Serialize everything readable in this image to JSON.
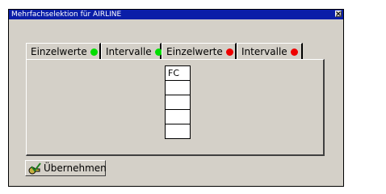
{
  "window": {
    "title": "Mehrfachselektion für AIRLINE"
  },
  "tabs": [
    {
      "label": "Einzelwerte",
      "dot_color": "#00dd00"
    },
    {
      "label": "Intervalle",
      "dot_color": "#00dd00"
    },
    {
      "label": "Einzelwerte",
      "dot_color": "#ee0000"
    },
    {
      "label": "Intervalle",
      "dot_color": "#ee0000"
    }
  ],
  "value_table": {
    "rows": [
      "FC",
      "",
      "",
      "",
      ""
    ]
  },
  "apply_button": {
    "label": "Übernehmen",
    "icon": "checkmark-key-icon"
  }
}
